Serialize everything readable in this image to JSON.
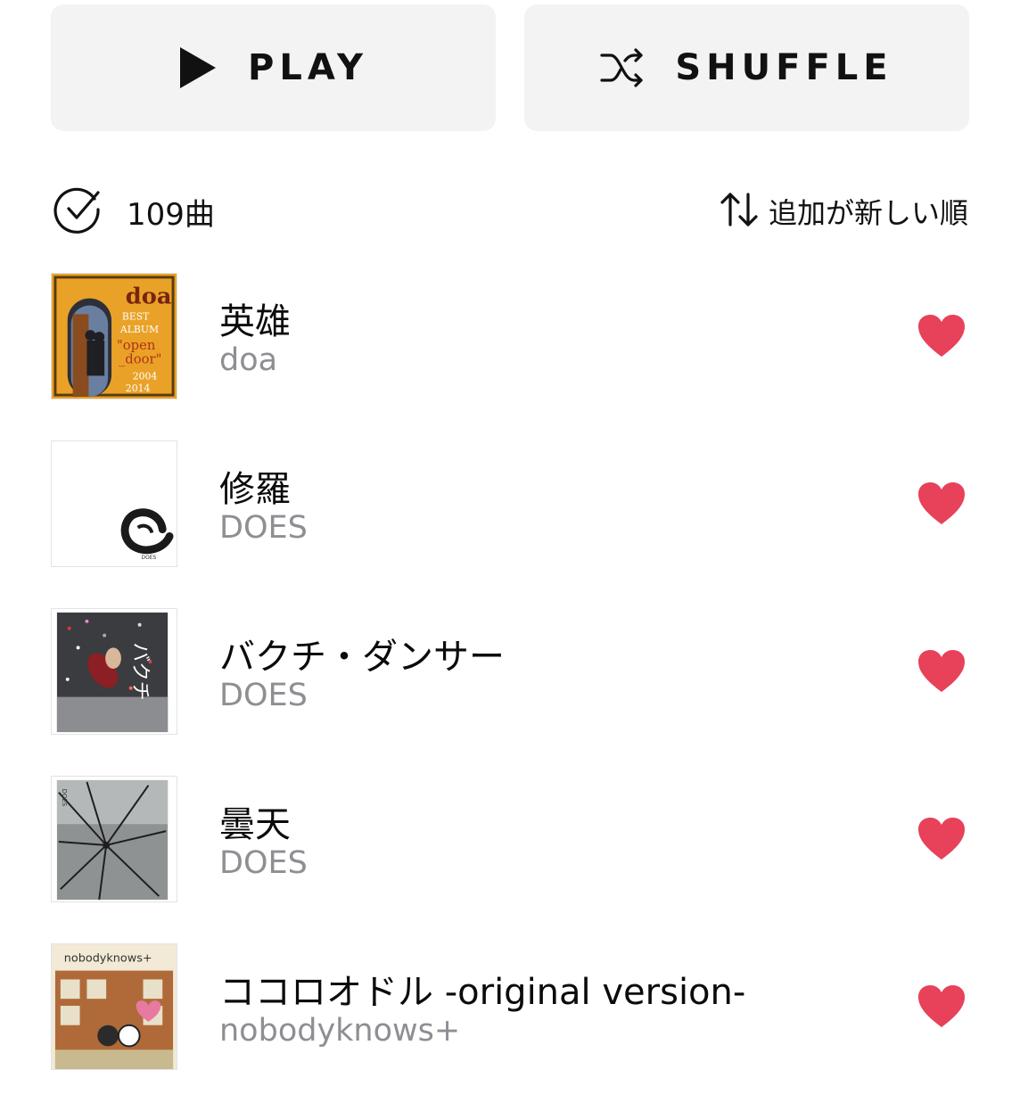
{
  "actions": {
    "play_label": "PLAY",
    "shuffle_label": "SHUFFLE"
  },
  "summary": {
    "count_label": "109曲",
    "sort_label": "追加が新しい順"
  },
  "tracks": [
    {
      "title": "英雄",
      "artist": "doa",
      "liked": true,
      "artwork_text": [
        "doa",
        "BEST",
        "ALBUM",
        "\"open",
        "_door\"",
        "2004",
        "2014"
      ]
    },
    {
      "title": "修羅",
      "artist": "DOES",
      "liked": true,
      "artwork_text": [
        "DOES"
      ]
    },
    {
      "title": "バクチ・ダンサー",
      "artist": "DOES",
      "liked": true,
      "artwork_text": [
        "バクチ"
      ]
    },
    {
      "title": "曇天",
      "artist": "DOES",
      "liked": true,
      "artwork_text": [
        "DOES"
      ]
    },
    {
      "title": "ココロオドル -original version-",
      "artist": "nobodyknows+",
      "liked": true,
      "artwork_text": [
        "nobodyknows+"
      ]
    }
  ],
  "colors": {
    "button_bg": "#f3f3f3",
    "heart": "#e8415a",
    "secondary_text": "#8e8e93"
  },
  "icons": {
    "play": "play-icon",
    "shuffle": "shuffle-icon",
    "select": "check-circle-icon",
    "sort": "sort-arrows-icon",
    "like": "heart-icon"
  }
}
